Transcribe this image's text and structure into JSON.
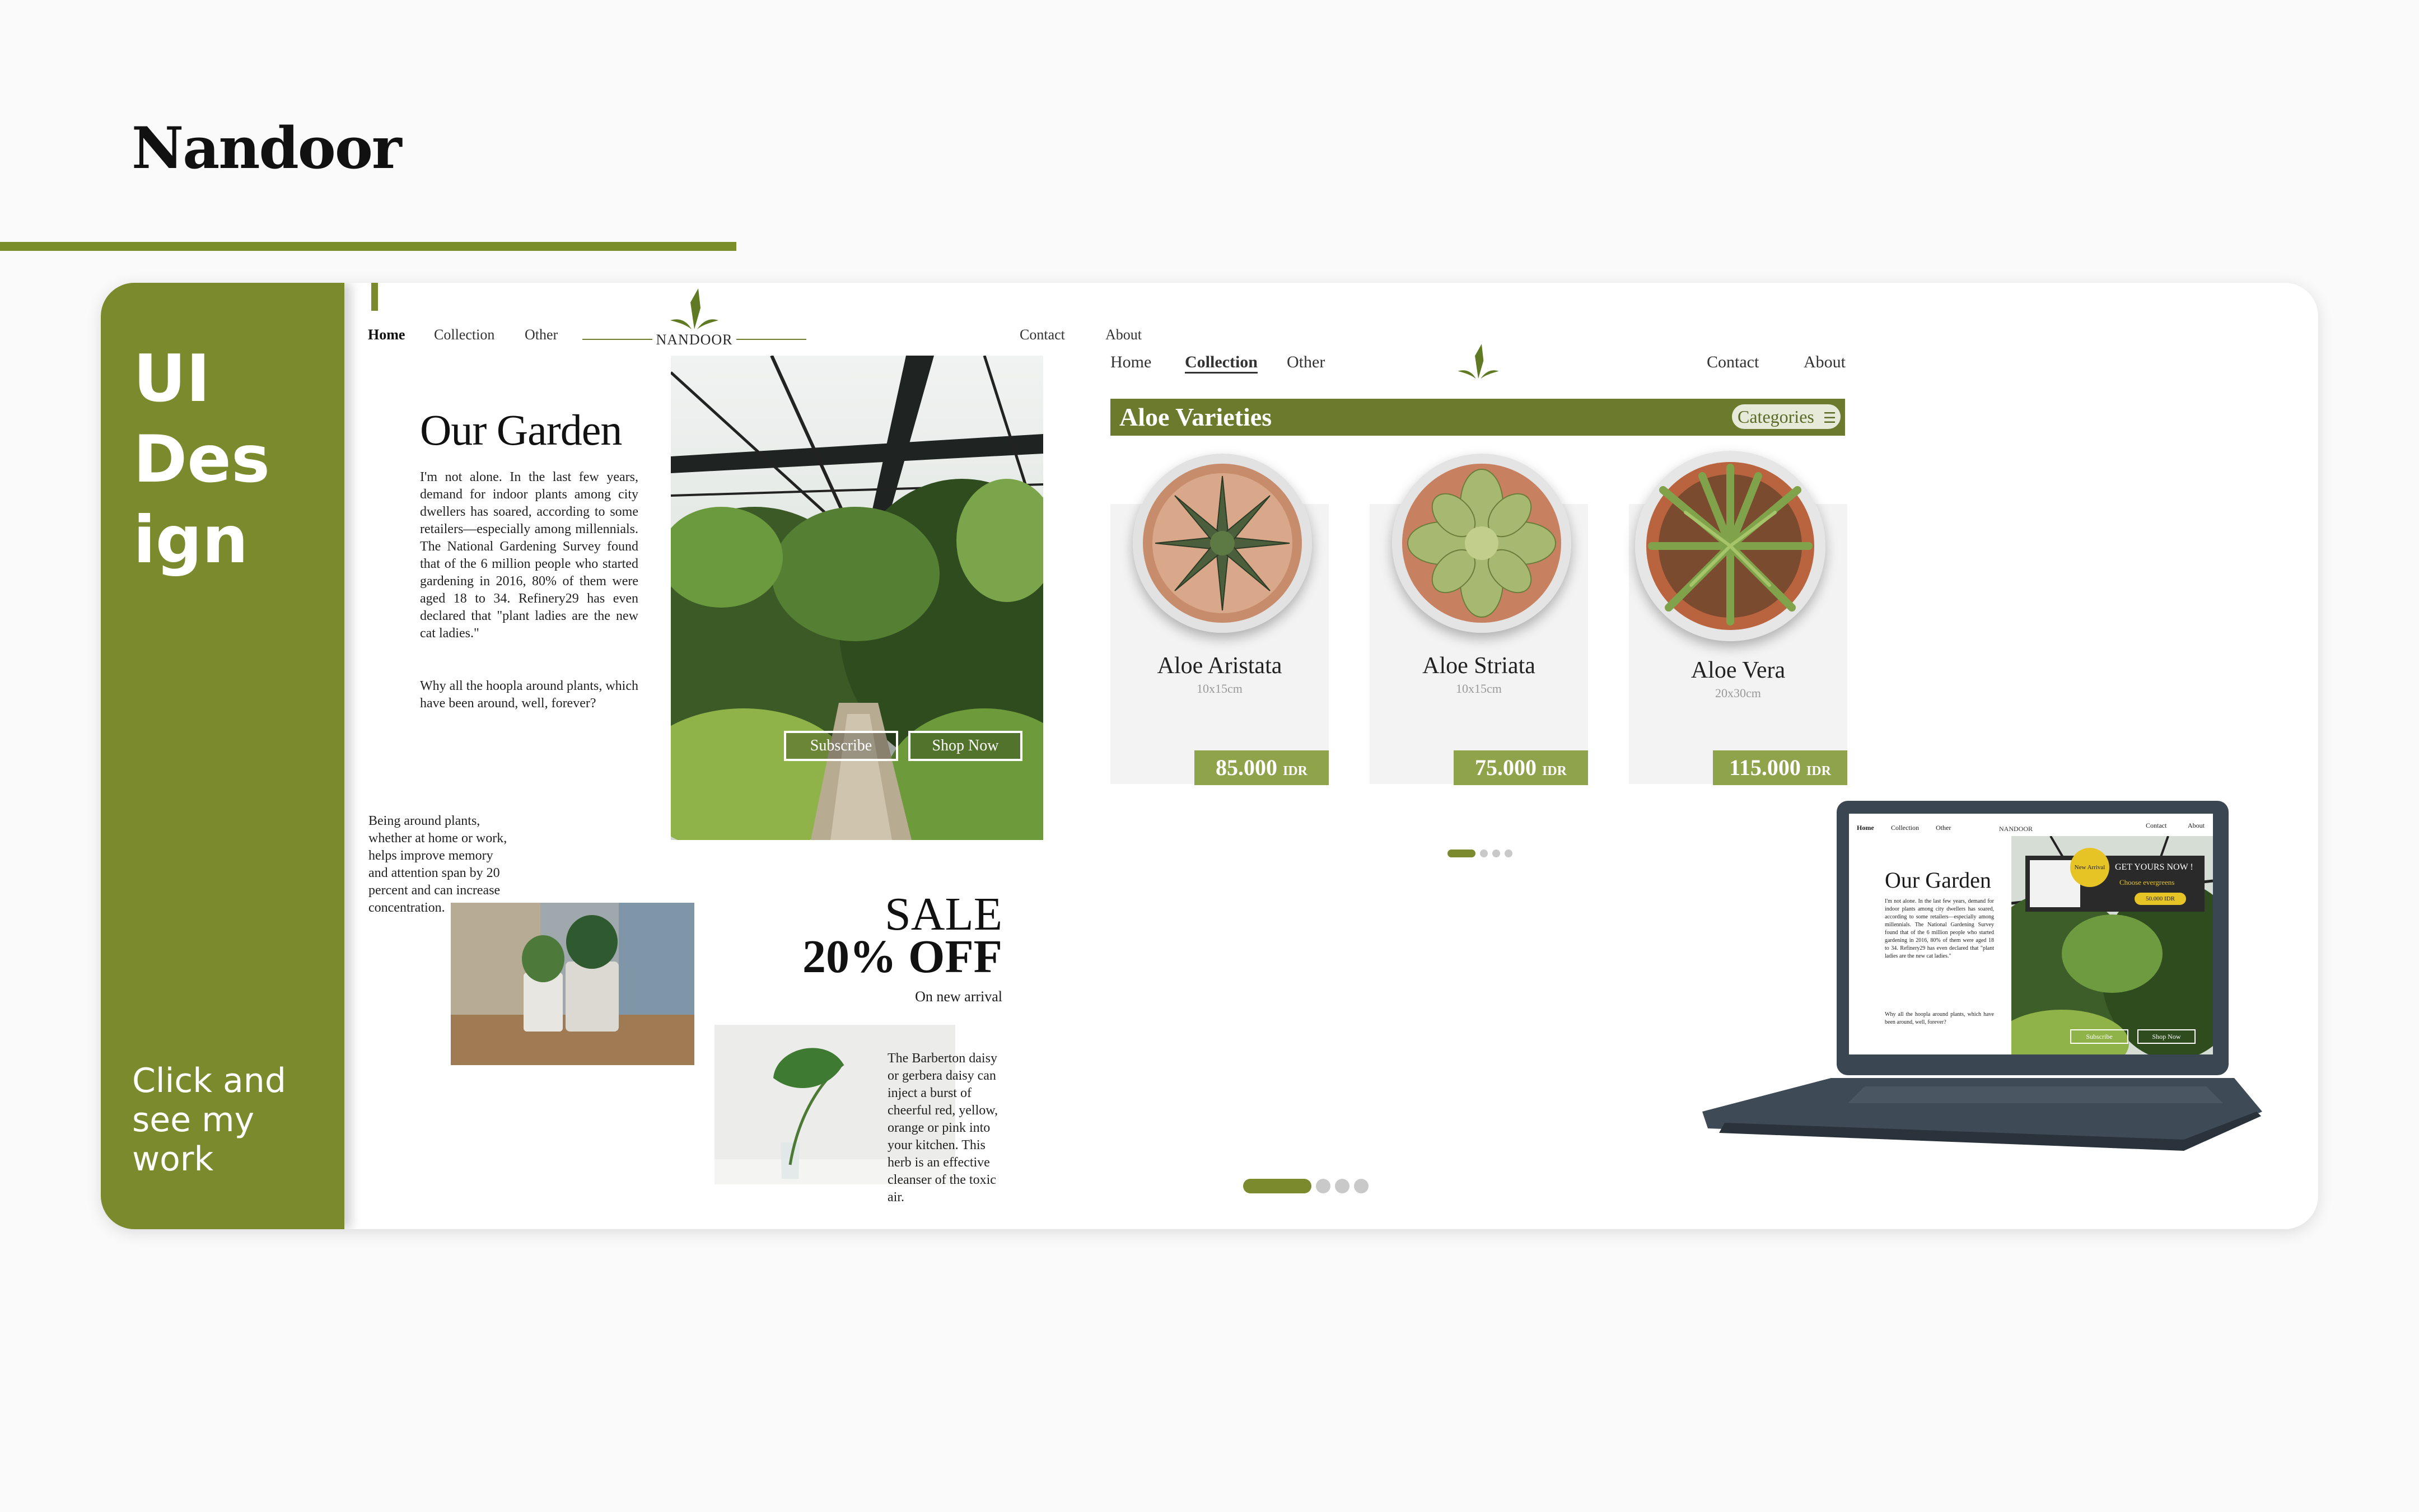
{
  "page": {
    "title": "Nandoor"
  },
  "colors": {
    "accent": "#7a8a2c",
    "accent_light": "#8fa34b",
    "banner": "#6b7a2d"
  },
  "sidebar": {
    "title": "UI\nDes\nign",
    "cta": "Click and\nsee my\nwork"
  },
  "mockup1": {
    "nav": {
      "home": "Home",
      "collection": "Collection",
      "other": "Other",
      "logo": "NANDOOR",
      "contact": "Contact",
      "about": "About"
    },
    "title": "Our Garden",
    "paragraph1": "I'm not alone. In the last few years, demand for indoor plants among city dwellers has soared, according to some retailers—especially among millennials. The National Gardening Survey found that of the 6 million people who started gardening in 2016, 80% of them were aged 18 to 34. Refinery29 has even declared that \"plant ladies are the new cat ladies.\"",
    "paragraph2": "Why all the hoopla around plants, which have been around, well, forever?",
    "subscribe": "Subscribe",
    "shop_now": "Shop Now",
    "side_text": "Being around plants, whether at home or work, helps improve memory and attention span by 20 percent and can increase concentration.",
    "sale_line1": "SALE",
    "sale_line2": "20% OFF",
    "sale_sub": "On new arrival",
    "daisy_text": "The Barberton daisy or gerbera daisy can inject a burst of cheerful red, yellow, orange or pink into your kitchen. This herb is an effective cleanser of the toxic air."
  },
  "mockup2": {
    "nav": {
      "home": "Home",
      "collection": "Collection",
      "other": "Other",
      "contact": "Contact",
      "about": "About"
    },
    "banner_title": "Aloe Varieties",
    "categories": "Categories",
    "products": [
      {
        "name": "Aloe Aristata",
        "size": "10x15cm",
        "price": "85.000",
        "currency": "IDR"
      },
      {
        "name": "Aloe Striata",
        "size": "10x15cm",
        "price": "75.000",
        "currency": "IDR"
      },
      {
        "name": "Aloe Vera",
        "size": "20x30cm",
        "price": "115.000",
        "currency": "IDR"
      }
    ]
  },
  "laptop": {
    "nav": {
      "home": "Home",
      "collection": "Collection",
      "other": "Other",
      "logo": "NANDOOR",
      "contact": "Contact",
      "about": "About"
    },
    "title": "Our Garden",
    "paragraph1": "I'm not alone. In the last few years, demand for indoor plants among city dwellers has soared, according to some retailers—especially among millennials. The National Gardening Survey found that of the 6 million people who started gardening in 2016, 80% of them were aged 18 to 34. Refinery29 has even declared that \"plant ladies are the new cat ladies.\"",
    "paragraph2": "Why all the hoopla around plants, which have been around, well, forever?",
    "promo_badge": "New Arrival",
    "promo_title": "GET YOURS NOW !",
    "promo_sub": "Choose evergreens",
    "promo_price": "50.000 IDR",
    "subscribe": "Subscribe",
    "shop_now": "Shop Now"
  }
}
